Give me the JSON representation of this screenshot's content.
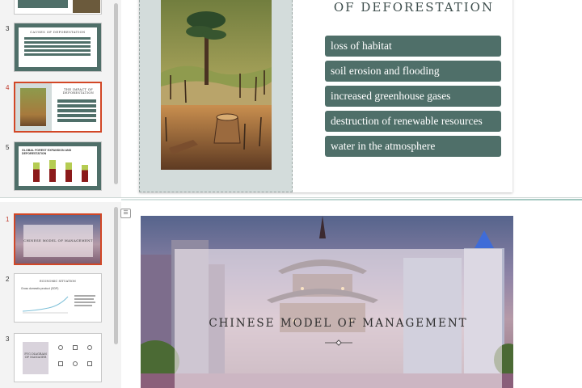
{
  "top_pane": {
    "thumbnails": [
      {
        "number": "",
        "title": ""
      },
      {
        "number": "3",
        "title": "CAUSES OF DEFORESTATION"
      },
      {
        "number": "4",
        "title": "THE IMPACT OF DEFORESTATION",
        "active": true
      },
      {
        "number": "5",
        "title": "GLOBAL FOREST EXPANSION AND DEFORESTATION"
      }
    ],
    "slide": {
      "title": "OF DEFORESTATION",
      "bullets": [
        "loss of habitat",
        "soil erosion and flooding",
        "increased greenhouse gases",
        "destruction of renewable resources",
        "water in the atmosphere"
      ]
    }
  },
  "bottom_pane": {
    "thumbnails": [
      {
        "number": "1",
        "title": "CHINESE MODEL OF MANAGEMENT",
        "active": true
      },
      {
        "number": "2",
        "title": "ECONOMIC SITUATION",
        "subtitle": "Gross domestic product (GDP)"
      },
      {
        "number": "3",
        "title": "PYG DIAGRAM OF MANAGER"
      }
    ],
    "slide": {
      "title": "CHINESE MODEL OF MANAGEMENT"
    }
  },
  "colors": {
    "accent_teal": "#4f6f69",
    "active_border": "#d24726",
    "panel_grey": "#d3dcdb"
  }
}
